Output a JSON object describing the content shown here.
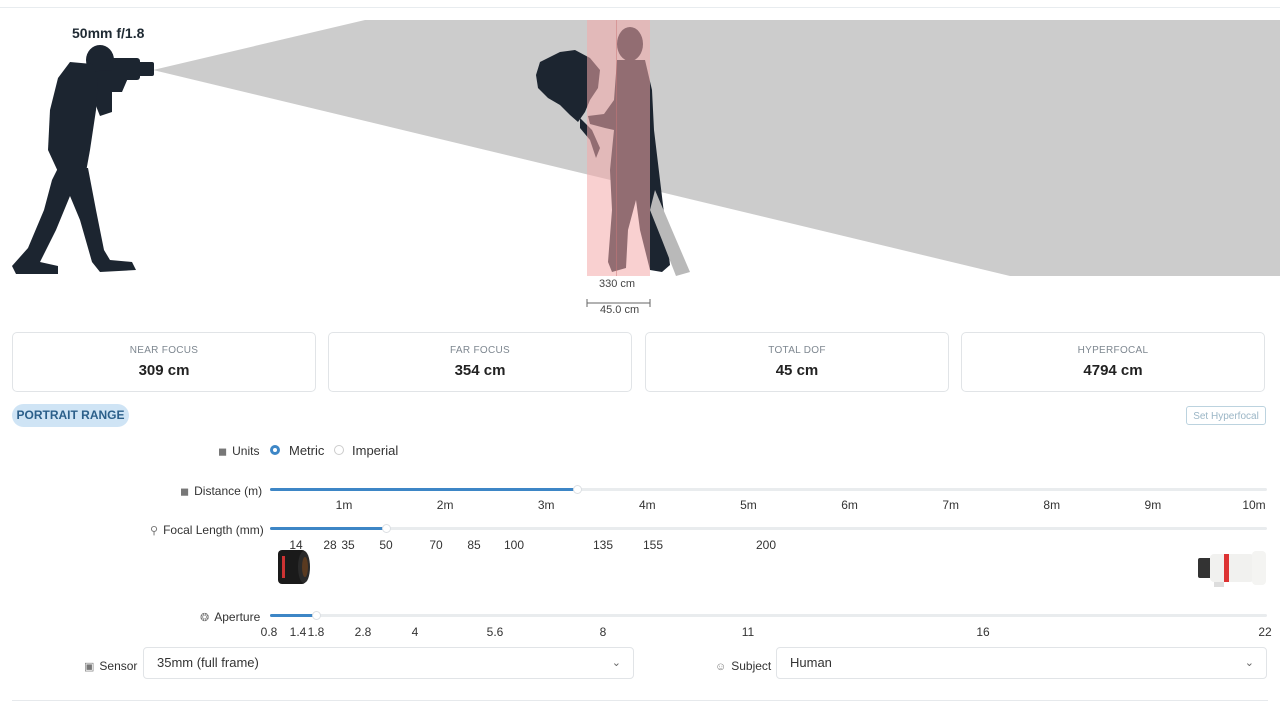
{
  "lens_label": "50mm f/1.8",
  "focus_dimensions": {
    "subject_distance": "330 cm",
    "dof_width": "45.0 cm"
  },
  "stats": [
    {
      "label": "NEAR FOCUS",
      "value": "309 cm"
    },
    {
      "label": "FAR FOCUS",
      "value": "354 cm"
    },
    {
      "label": "TOTAL DOF",
      "value": "45 cm"
    },
    {
      "label": "HYPERFOCAL",
      "value": "4794 cm"
    }
  ],
  "range_badge": "PORTRAIT RANGE",
  "hyperfocal_button": "Set Hyperfocal",
  "units": {
    "label": "Units",
    "options": [
      "Metric",
      "Imperial"
    ],
    "selected": "Metric"
  },
  "distance": {
    "label": "Distance (m)",
    "ticks": [
      "1m",
      "2m",
      "3m",
      "4m",
      "5m",
      "6m",
      "7m",
      "8m",
      "9m",
      "10m"
    ],
    "value_m": 3.3
  },
  "focal_length": {
    "label": "Focal Length (mm)",
    "ticks": [
      "14",
      "28",
      "35",
      "50",
      "70",
      "85",
      "100",
      "135",
      "155",
      "200"
    ],
    "value_mm": 50
  },
  "aperture": {
    "label": "Aperture",
    "ticks": [
      "0.8",
      "1.4",
      "1.8",
      "2.8",
      "4",
      "5.6",
      "8",
      "11",
      "16",
      "22"
    ],
    "value": 1.8
  },
  "sensor": {
    "label": "Sensor",
    "value": "35mm (full frame)"
  },
  "subject": {
    "label": "Subject",
    "value": "Human"
  },
  "colors": {
    "accent": "#3d86c6",
    "cone": "#cccccc",
    "dof_zone": "#f4a9a9",
    "silhouette": "#1c2530"
  },
  "icons": [
    "ruler-icon",
    "zoom-icon",
    "aperture-icon",
    "camera-icon",
    "person-icon",
    "chevron-down-icon"
  ]
}
